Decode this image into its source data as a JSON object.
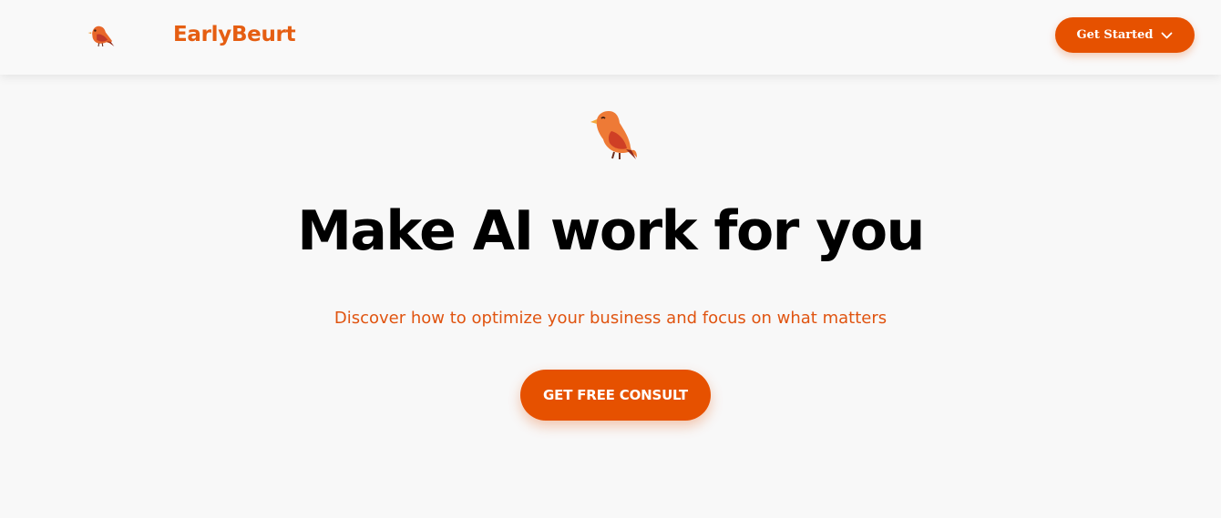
{
  "navbar": {
    "logo_icon": "bird-icon",
    "brand_name": "EarlyBeurt",
    "get_started": {
      "label": "Get Started",
      "icon": "chevron-down-icon"
    }
  },
  "hero": {
    "logo_icon": "bird-icon",
    "headline": "Make AI work for you",
    "subheadline": "Discover how to optimize your business and focus on what matters",
    "cta_label": "GET FREE CONSULT"
  },
  "colors": {
    "accent": "#e65100",
    "brand_text": "#e55e12",
    "background": "#f8f8f8",
    "headline": "#000000"
  }
}
